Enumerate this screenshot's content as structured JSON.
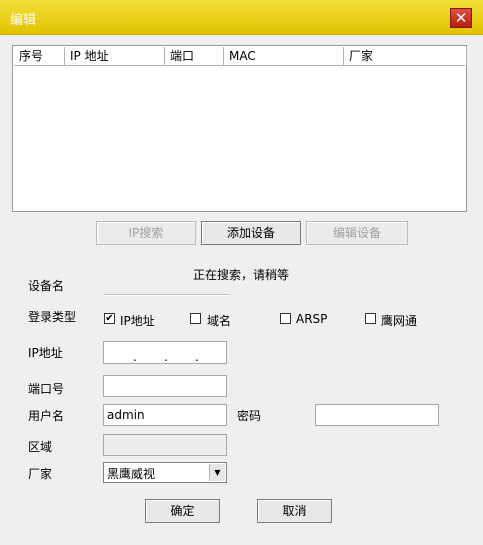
{
  "window": {
    "title": "编辑",
    "close_glyph": "✕"
  },
  "device_list": {
    "columns": [
      "序号",
      "IP 地址",
      "端口",
      "MAC",
      "厂家"
    ],
    "rows": []
  },
  "list_buttons": {
    "ip_search": "IP搜索",
    "add_device": "添加设备",
    "edit_device": "编辑设备"
  },
  "form": {
    "device_name_label": "设备名",
    "status_text": "正在搜索，请稍等",
    "login_type_label": "登录类型",
    "login_types": [
      {
        "label": "IP地址",
        "checked": true
      },
      {
        "label": "域名",
        "checked": false
      },
      {
        "label": "ARSP",
        "checked": false
      },
      {
        "label": "鹰网通",
        "checked": false
      }
    ],
    "ip_label": "IP地址",
    "ip_dots": ".",
    "port_label": "端口号",
    "port_value": "",
    "username_label": "用户名",
    "username_value": "admin",
    "password_label": "密码",
    "password_value": "",
    "region_label": "区域",
    "region_value": "",
    "vendor_label": "厂家",
    "vendor_value": "黑鹰威视"
  },
  "footer": {
    "ok": "确定",
    "cancel": "取消"
  }
}
